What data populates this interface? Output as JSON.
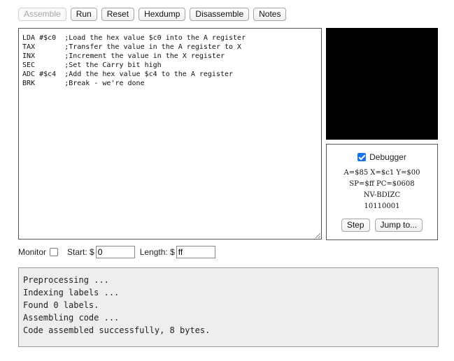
{
  "toolbar": {
    "assemble": "Assemble",
    "run": "Run",
    "reset": "Reset",
    "hexdump": "Hexdump",
    "disassemble": "Disassemble",
    "notes": "Notes"
  },
  "editor": {
    "lines": [
      "LDA #$c0  ;Load the hex value $c0 into the A register",
      "TAX       ;Transfer the value in the A register to X",
      "INX       ;Increment the value in the X register",
      "SEC       ;Set the Carry bit high",
      "ADC #$c4  ;Add the hex value $c4 to the A register",
      "BRK       ;Break - we're done"
    ]
  },
  "debugger": {
    "label": "Debugger",
    "checked": true,
    "registers": [
      "A=$85 X=$c1 Y=$00",
      "SP=$ff PC=$0608",
      "NV-BDIZC",
      "10110001"
    ],
    "step": "Step",
    "jump": "Jump to..."
  },
  "monitor": {
    "label": "Monitor",
    "checked": false,
    "start_label": "Start: $",
    "start_value": "0",
    "length_label": "Length: $",
    "length_value": "ff"
  },
  "console": {
    "lines": [
      "Preprocessing ...",
      "Indexing labels ...",
      "Found 0 labels.",
      "Assembling code ...",
      "Code assembled successfully, 8 bytes."
    ]
  },
  "colors": {
    "screen_bg": "#000000",
    "console_bg": "#eeeeee",
    "checkbox_accent": "#1a73e8"
  }
}
